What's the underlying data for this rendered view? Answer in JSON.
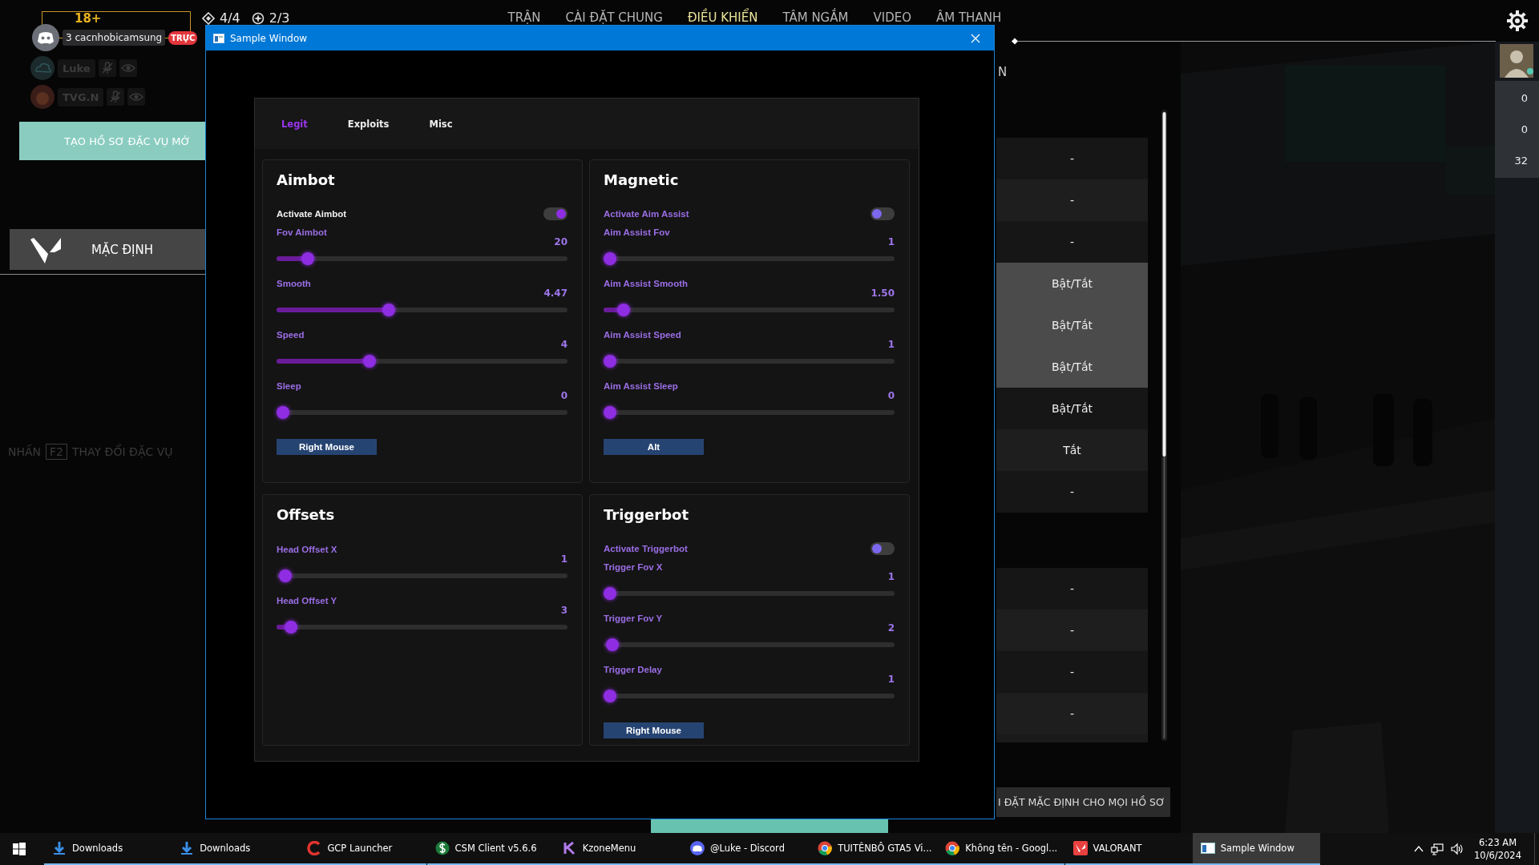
{
  "game": {
    "age_badge": "18+",
    "counters": [
      {
        "kind": "charge",
        "text": "4/4"
      },
      {
        "kind": "ultimate",
        "text": "2/3"
      }
    ],
    "nav": [
      {
        "label": "TRẬN",
        "selected": false
      },
      {
        "label": "CÀI ĐẶT CHUNG",
        "selected": false
      },
      {
        "label": "ĐIỀU KHIỂN",
        "selected": true
      },
      {
        "label": "TÂM NGẮM",
        "selected": false
      },
      {
        "label": "VIDEO",
        "selected": false
      },
      {
        "label": "ÂM THANH",
        "selected": false
      }
    ],
    "discord": {
      "user": "3 cacnhobicamsung",
      "live_badge": "TRỰC",
      "members": [
        {
          "name": "Luke"
        },
        {
          "name": "TVG.N"
        }
      ]
    },
    "create_profile_button": "TẠO HỒ SƠ ĐẶC VỤ MỚ",
    "profile": "MẶC ĐỊNH",
    "hint": {
      "before": "NHẤN",
      "key": "F2",
      "after": "THAY ĐỔI ĐẶC VỤ"
    },
    "section_heading_tail": "N",
    "bind_groups": [
      {
        "rows": [
          {
            "text": "-",
            "highlighted": false
          },
          {
            "text": "-",
            "highlighted": false
          },
          {
            "text": "-",
            "highlighted": false
          },
          {
            "text": "Bật/Tắt",
            "highlighted": true
          },
          {
            "text": "Bật/Tắt",
            "highlighted": true
          },
          {
            "text": "Bật/Tắt",
            "highlighted": true
          },
          {
            "text": "Bật/Tắt",
            "highlighted": false
          },
          {
            "text": "Tắt",
            "highlighted": false
          },
          {
            "text": "-",
            "highlighted": false
          }
        ]
      },
      {
        "rows": [
          {
            "text": "-",
            "highlighted": false
          },
          {
            "text": "-",
            "highlighted": false
          },
          {
            "text": "-",
            "highlighted": false
          },
          {
            "text": "-",
            "highlighted": false
          }
        ]
      }
    ],
    "reset_button": "I ĐẶT MẶC ĐỊNH CHO MỌI HỒ SƠ",
    "stats": [
      "0",
      "0",
      "32"
    ]
  },
  "window": {
    "title": "Sample Window",
    "tabs": [
      {
        "label": "Legit",
        "selected": true
      },
      {
        "label": "Exploits",
        "selected": false
      },
      {
        "label": "Misc",
        "selected": false
      }
    ],
    "cards": [
      {
        "title": "Aimbot",
        "items": [
          {
            "kind": "toggle",
            "label": "Activate Aimbot",
            "on": true
          },
          {
            "kind": "slider",
            "label": "Fov Aimbot",
            "value": "20",
            "level": 0.09
          },
          {
            "kind": "slider",
            "label": "Smooth",
            "value": "4.47",
            "level": 0.38
          },
          {
            "kind": "slider",
            "label": "Speed",
            "value": "4",
            "level": 0.31
          },
          {
            "kind": "slider",
            "label": "Sleep",
            "value": "0",
            "level": 0
          },
          {
            "kind": "key",
            "label": "Right Mouse"
          }
        ]
      },
      {
        "title": "Magnetic",
        "items": [
          {
            "kind": "toggle",
            "label": "Activate Aim Assist",
            "on": false
          },
          {
            "kind": "slider",
            "label": "Aim Assist Fov",
            "value": "1",
            "level": 0
          },
          {
            "kind": "slider",
            "label": "Aim Assist Smooth",
            "value": "1.50",
            "level": 0.05
          },
          {
            "kind": "slider",
            "label": "Aim Assist Speed",
            "value": "1",
            "level": 0
          },
          {
            "kind": "slider",
            "label": "Aim Assist Sleep",
            "value": "0",
            "level": 0
          },
          {
            "kind": "key",
            "label": "Alt"
          }
        ]
      },
      {
        "title": "Offsets",
        "items": [
          {
            "kind": "slider",
            "label": "Head Offset X",
            "value": "1",
            "level": 0.01
          },
          {
            "kind": "slider",
            "label": "Head Offset Y",
            "value": "3",
            "level": 0.03
          }
        ]
      },
      {
        "title": "Triggerbot",
        "items": [
          {
            "kind": "toggle",
            "label": "Activate Triggerbot",
            "on": false
          },
          {
            "kind": "slider",
            "label": "Trigger Fov X",
            "value": "1",
            "level": 0
          },
          {
            "kind": "slider",
            "label": "Trigger Fov Y",
            "value": "2",
            "level": 0.01
          },
          {
            "kind": "slider",
            "label": "Trigger Delay",
            "value": "1",
            "level": 0
          },
          {
            "kind": "key",
            "label": "Right Mouse"
          }
        ]
      }
    ]
  },
  "taskbar": {
    "items": [
      {
        "kind": "download",
        "label": "Downloads",
        "selected": false
      },
      {
        "kind": "download",
        "label": "Downloads",
        "selected": false
      },
      {
        "kind": "launcher",
        "label": "GCP Launcher",
        "selected": false
      },
      {
        "kind": "client",
        "label": "CSM Client v5.6.6",
        "selected": false
      },
      {
        "kind": "menu",
        "label": "KzoneMenu",
        "selected": false
      },
      {
        "kind": "chat",
        "label": "@Luke - Discord",
        "selected": false
      },
      {
        "kind": "browser",
        "label": "TUITÊNBÔ GTA5 Vi...",
        "selected": false
      },
      {
        "kind": "browser",
        "label": "Không tên - Googl...",
        "selected": false
      },
      {
        "kind": "game",
        "label": "VALORANT",
        "selected": false
      },
      {
        "kind": "window",
        "label": "Sample Window",
        "selected": true
      }
    ],
    "clock": {
      "time": "6:23 AM",
      "date": "10/6/2024"
    }
  }
}
